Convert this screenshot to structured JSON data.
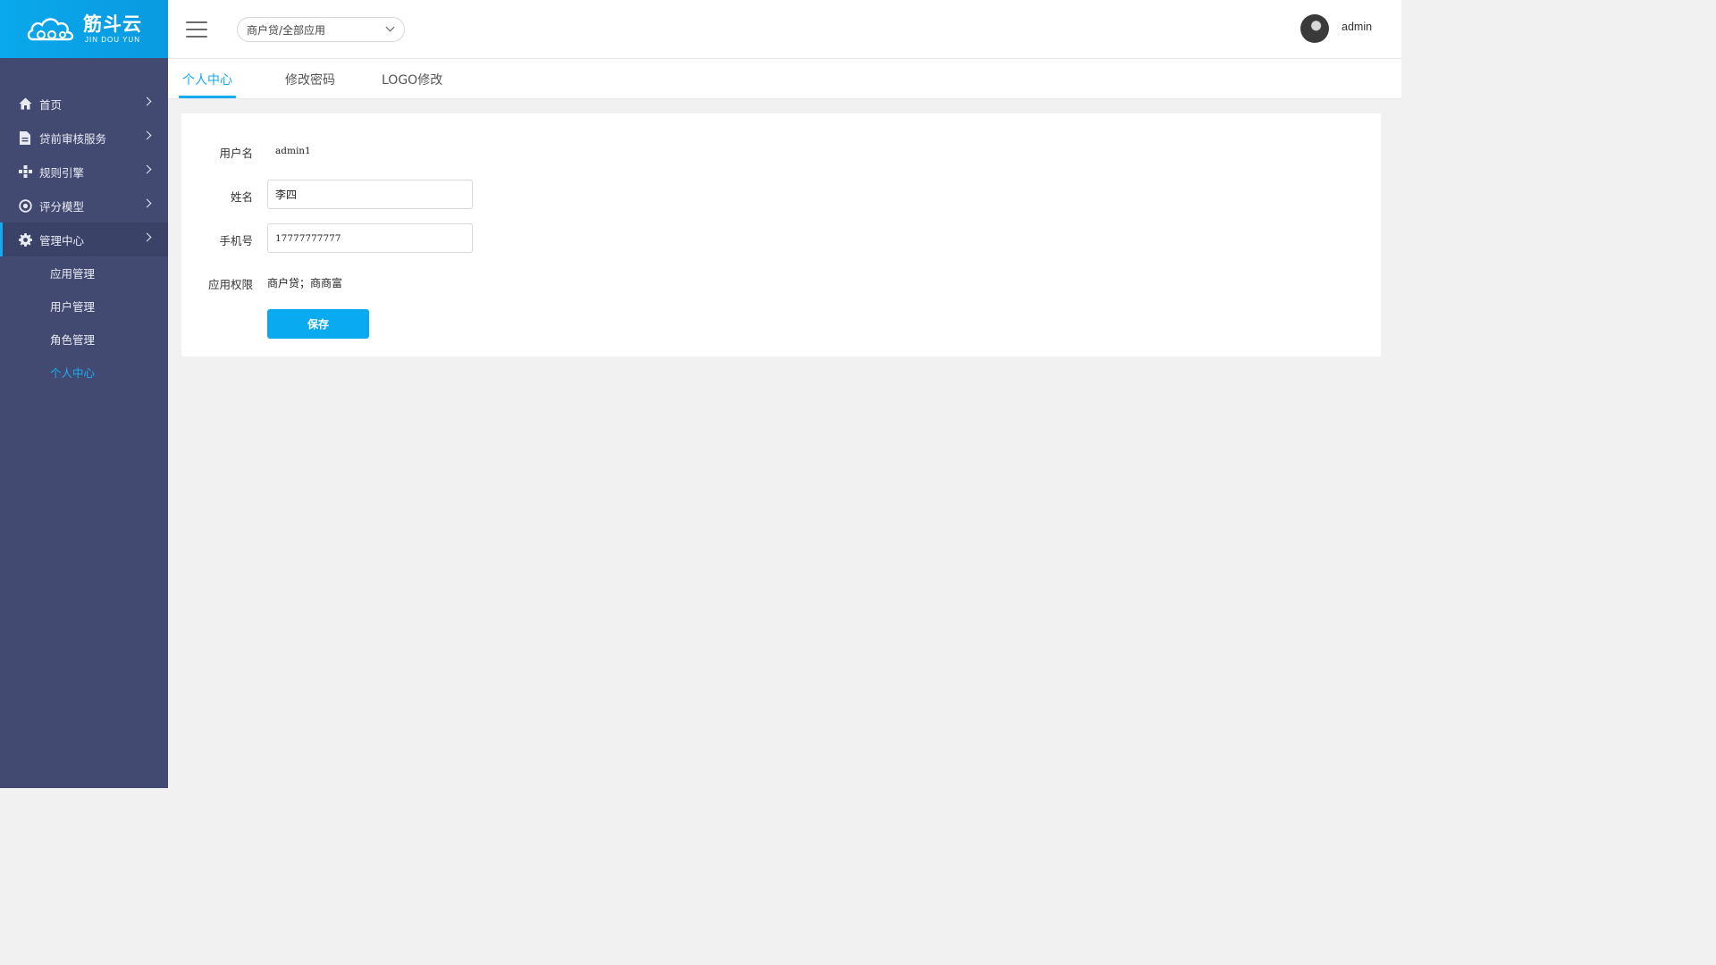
{
  "logo": {
    "name_cn": "筋斗云",
    "name_en": "JIN DOU YUN"
  },
  "sidebar": {
    "items": [
      {
        "label": "首页",
        "icon": "home-icon"
      },
      {
        "label": "贷前审核服务",
        "icon": "document-icon"
      },
      {
        "label": "规则引擎",
        "icon": "nodes-icon"
      },
      {
        "label": "评分模型",
        "icon": "target-icon"
      },
      {
        "label": "管理中心",
        "icon": "gear-icon",
        "expanded": true
      }
    ],
    "subitems": [
      {
        "label": "应用管理"
      },
      {
        "label": "用户管理"
      },
      {
        "label": "角色管理"
      },
      {
        "label": "个人中心",
        "current": true
      }
    ]
  },
  "header": {
    "app_select": "商户贷/全部应用",
    "username": "admin"
  },
  "tabs": [
    {
      "label": "个人中心",
      "active": true
    },
    {
      "label": "修改密码"
    },
    {
      "label": "LOGO修改"
    }
  ],
  "form": {
    "username_label": "用户名",
    "username_value": "admin1",
    "name_label": "姓名",
    "name_value": "李四",
    "phone_label": "手机号",
    "phone_value": "17777777777",
    "perm_label": "应用权限",
    "perm_value": "商户贷；商商富",
    "save_label": "保存"
  },
  "colors": {
    "accent": "#0aaaf0",
    "sidebar_bg": "#434a72",
    "logo_bg": "#0aa8ec"
  }
}
